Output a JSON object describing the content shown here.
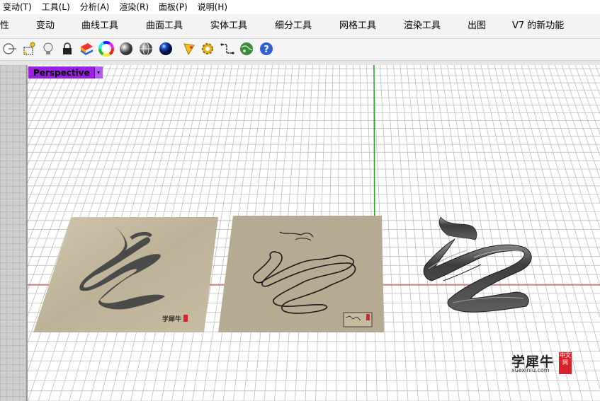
{
  "menubar": {
    "items": [
      "变动(T)",
      "工具(L)",
      "分析(A)",
      "渲染(R)",
      "面板(P)",
      "说明(H)"
    ]
  },
  "tabs": {
    "items": [
      "性",
      "变动",
      "曲线工具",
      "曲面工具",
      "实体工具",
      "细分工具",
      "网格工具",
      "渲染工具",
      "出图",
      "V7 的新功能"
    ]
  },
  "toolbar": {
    "icons": [
      "dimension-icon",
      "select-points-icon",
      "light-bulb-icon",
      "lock-icon",
      "layer-color-icon",
      "color-wheel-icon",
      "shaded-sphere-icon",
      "wireframe-sphere-icon",
      "rendered-sphere-icon",
      "analyze-icon",
      "settings-gear-icon",
      "dimension-offset-icon",
      "world-globe-icon",
      "help-icon"
    ]
  },
  "viewport": {
    "label": "Perspective",
    "menu_arrow": "▾"
  },
  "scene": {
    "panel1_seal": "学犀牛",
    "colors": {
      "accent_purple": "#9b1fe0",
      "grid_line": "#bdbdbd",
      "y_axis": "#1faa1f",
      "x_axis": "#c03030",
      "stone_panel": "#c2b59c",
      "trace_panel": "#b5a992",
      "extrusion": "#4d4d4d"
    }
  },
  "watermark": {
    "brand": "学犀牛",
    "url": "xuexiniu.com",
    "seal": "中文网"
  }
}
